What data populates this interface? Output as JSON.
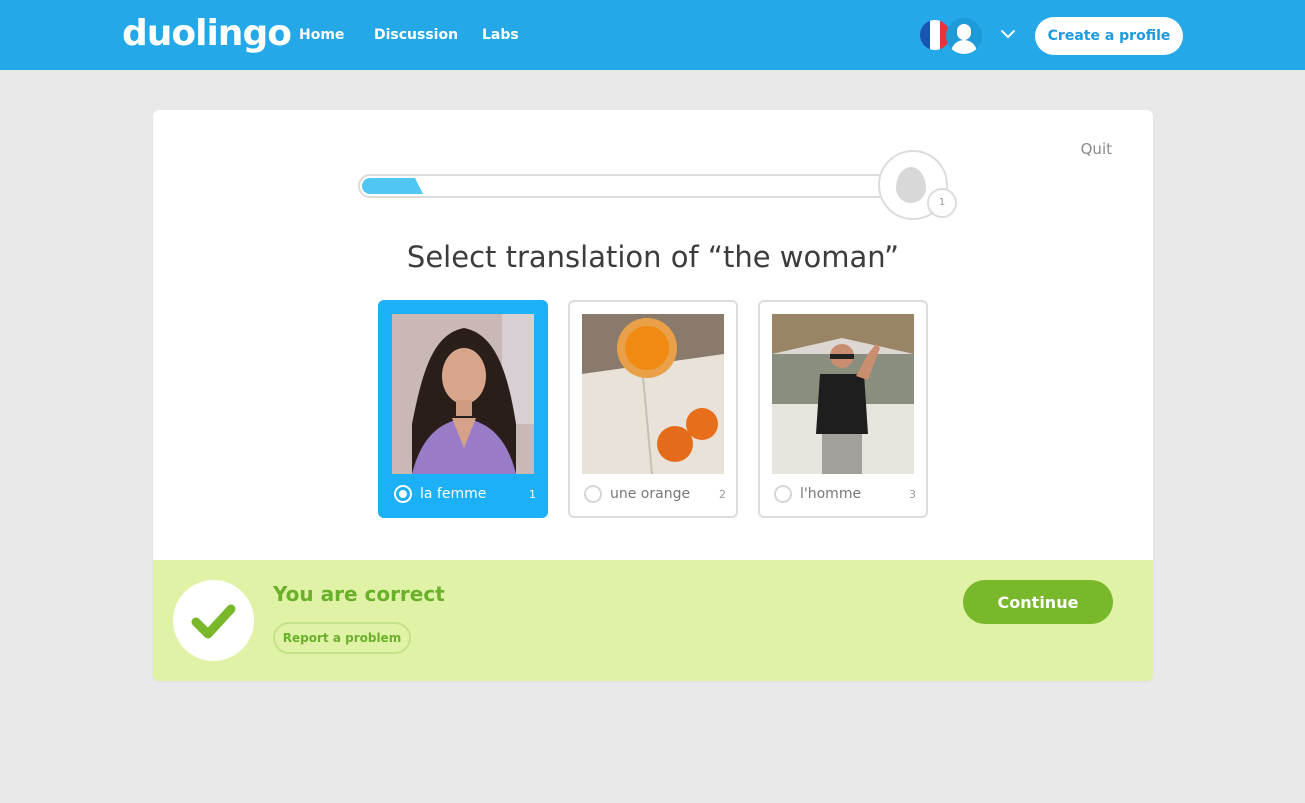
{
  "colors": {
    "brand_blue": "#25a8e8",
    "selected_blue": "#1cb0f6",
    "progress_blue": "#4fc6f4",
    "success_green": "#78b82a",
    "success_bg": "#dff2a6",
    "flag_blue": "#1a55b4",
    "flag_white": "#ffffff",
    "flag_red": "#e8323c"
  },
  "header": {
    "logo": "duolingo",
    "nav": [
      {
        "label": "Home"
      },
      {
        "label": "Discussion"
      },
      {
        "label": "Labs"
      }
    ],
    "language_flag_icon": "france-flag-icon",
    "avatar_icon": "user-avatar-icon",
    "menu_icon": "chevron-down-icon",
    "create_profile": "Create a profile"
  },
  "lesson": {
    "quit": "Quit",
    "progress_fraction": 0.1,
    "reward_icon": "egg-icon",
    "reward_count": "1",
    "prompt": "Select translation of “the woman”",
    "choices": [
      {
        "label": "la femme",
        "key": "1",
        "selected": true,
        "image": "photo of a woman with long dark hair"
      },
      {
        "label": "une orange",
        "key": "2",
        "selected": false,
        "image": "photo of orange juice and oranges on a book"
      },
      {
        "label": "l'homme",
        "key": "3",
        "selected": false,
        "image": "photo of a man waving on a beach"
      }
    ]
  },
  "feedback": {
    "icon": "checkmark-icon",
    "message": "You are correct",
    "report": "Report a problem",
    "continue": "Continue"
  }
}
